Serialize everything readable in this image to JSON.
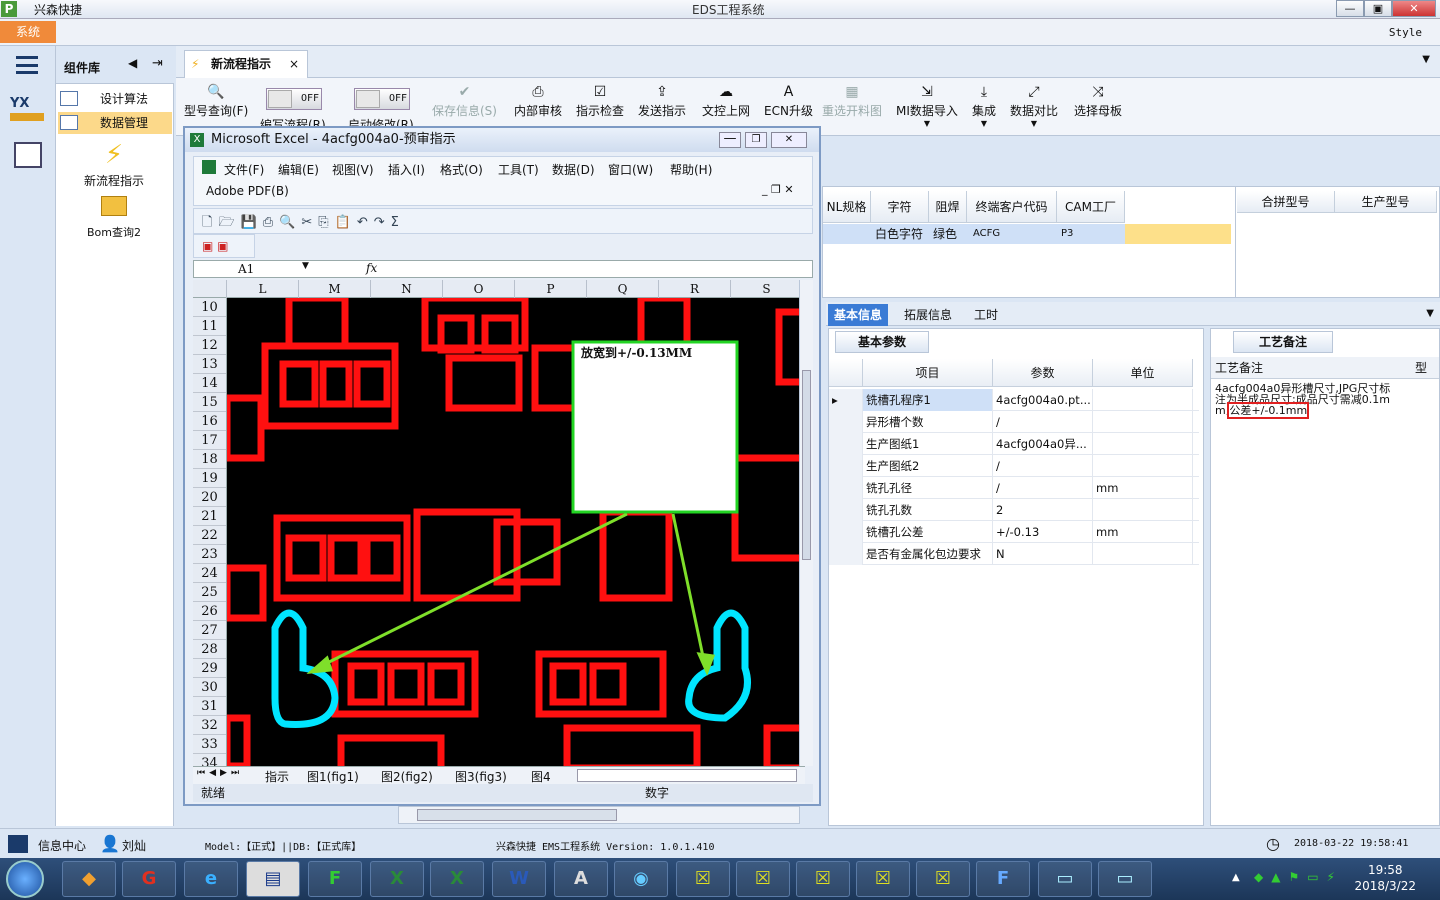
{
  "window": {
    "app_short": "兴森快捷",
    "title": "EDS工程系统",
    "min": "—",
    "max": "▣",
    "close": "✕"
  },
  "menubar": {
    "system": "系统",
    "style": "Style"
  },
  "component_lib": {
    "title": "组件库",
    "items": [
      {
        "label": "设计算法"
      },
      {
        "label": "数据管理"
      }
    ],
    "new_flow": "新流程指示",
    "bom": "Bom查询2"
  },
  "tab": {
    "label": "新流程指示",
    "close": "×"
  },
  "ribbon": {
    "buttons": [
      "型号查询(F)",
      "保存信息(S)",
      "内部审核",
      "指示检查",
      "发送指示",
      "文控上网",
      "ECN升级",
      "重选开料图",
      "MI数据导入",
      "集成",
      "数据对比",
      "选择母板"
    ],
    "toggle_off": "OFF",
    "toggle_labels": [
      "编写流程(R)",
      "启动修改(R)"
    ]
  },
  "top_list": {
    "headers": [
      "NL规格",
      "字符",
      "阻焊",
      "终端客户代码",
      "CAM工厂",
      "合拼型号",
      "生产型号"
    ],
    "row": [
      "白色字符",
      "绿色",
      "ACFG",
      "P3"
    ]
  },
  "lower_tabs": [
    "基本信息",
    "拓展信息",
    "工时"
  ],
  "basic_params": {
    "tab": "基本参数",
    "headers": [
      "项目",
      "参数",
      "单位"
    ],
    "rows": [
      {
        "item": "铣槽孔程序1",
        "value": "4acfg004a0.pt...",
        "unit": ""
      },
      {
        "item": "异形槽个数",
        "value": "/",
        "unit": ""
      },
      {
        "item": "生产图纸1",
        "value": "4acfg004a0异...",
        "unit": ""
      },
      {
        "item": "生产图纸2",
        "value": "/",
        "unit": ""
      },
      {
        "item": "铣孔孔径",
        "value": "/",
        "unit": "mm"
      },
      {
        "item": "铣孔孔数",
        "value": "2",
        "unit": ""
      },
      {
        "item": "铣槽孔公差",
        "value": "+/-0.13",
        "unit": "mm"
      },
      {
        "item": "是否有金属化包边要求",
        "value": "N",
        "unit": ""
      }
    ]
  },
  "process_note": {
    "tab": "工艺备注",
    "header": "工艺备注",
    "col2": "型",
    "text": "4acfg004a0异形槽尺寸,JPG尺寸标注为半成品尺寸;成品尺寸需减0.1mm;",
    "highlight": "公差+/-0.1mm"
  },
  "excel": {
    "title": "Microsoft Excel - 4acfg004a0-预审指示",
    "menu": [
      "文件(F)",
      "编辑(E)",
      "视图(V)",
      "插入(I)",
      "格式(O)",
      "工具(T)",
      "数据(D)",
      "窗口(W)",
      "帮助(H)"
    ],
    "adobe": "Adobe PDF(B)",
    "cell_ref": "A1",
    "fx": "fx",
    "columns": [
      "L",
      "M",
      "N",
      "O",
      "P",
      "Q",
      "R",
      "S"
    ],
    "rows": [
      "10",
      "11",
      "12",
      "13",
      "14",
      "15",
      "16",
      "17",
      "18",
      "19",
      "20",
      "21",
      "22",
      "23",
      "24",
      "25",
      "26",
      "27",
      "28",
      "29",
      "30",
      "31",
      "32",
      "33",
      "34"
    ],
    "note": "放宽到+/-0.13MM",
    "sheets": [
      "指示",
      "图1(fig1)",
      "图2(fig2)",
      "图3(fig3)",
      "图4"
    ],
    "status_ready": "就绪",
    "status_num": "数字"
  },
  "footer": {
    "info_center": "信息中心",
    "user": "刘灿",
    "model": "Model:【正式】||DB:【正式库】",
    "version": "兴森快捷 EMS工程系统 Version: 1.0.1.410",
    "datetime": "2018-03-22 19:58:41"
  },
  "taskbar": {
    "time": "19:58",
    "date": "2018/3/22"
  }
}
